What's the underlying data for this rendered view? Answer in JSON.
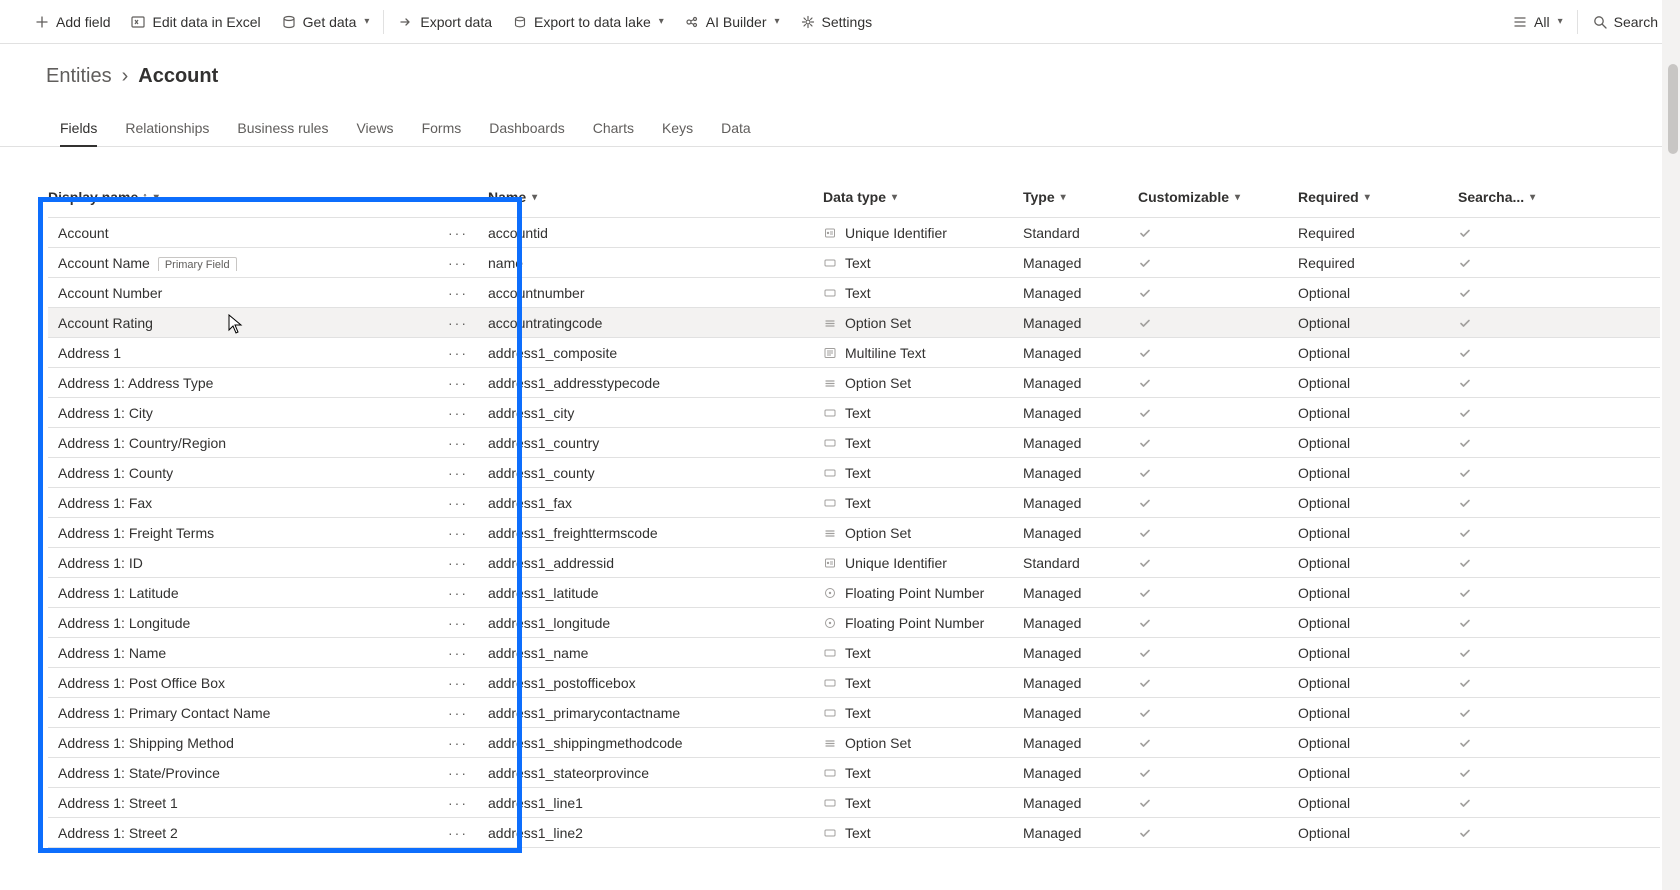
{
  "commandBar": {
    "left": [
      {
        "icon": "plus",
        "label": "Add field"
      },
      {
        "icon": "excel",
        "label": "Edit data in Excel"
      },
      {
        "icon": "db",
        "label": "Get data",
        "dropdown": true,
        "sepAfter": true
      },
      {
        "icon": "export",
        "label": "Export data"
      },
      {
        "icon": "lake",
        "label": "Export to data lake",
        "dropdown": true
      },
      {
        "icon": "ai",
        "label": "AI Builder",
        "dropdown": true
      },
      {
        "icon": "gear",
        "label": "Settings"
      }
    ],
    "right": {
      "filterLabel": "All",
      "searchPlaceholder": "Search"
    }
  },
  "breadcrumb": {
    "parent": "Entities",
    "current": "Account"
  },
  "tabs": [
    "Fields",
    "Relationships",
    "Business rules",
    "Views",
    "Forms",
    "Dashboards",
    "Charts",
    "Keys",
    "Data"
  ],
  "activeTab": 0,
  "columns": {
    "display": "Display name",
    "name": "Name",
    "dtype": "Data type",
    "type": "Type",
    "custom": "Customizable",
    "req": "Required",
    "search": "Searcha..."
  },
  "primaryBadge": "Primary Field",
  "rows": [
    {
      "display": "Account",
      "name": "accountid",
      "dtype": "Unique Identifier",
      "dicon": "id",
      "type": "Standard",
      "custom": true,
      "req": "Required",
      "search": true
    },
    {
      "display": "Account Name",
      "primary": true,
      "name": "name",
      "dtype": "Text",
      "dicon": "text",
      "type": "Managed",
      "custom": true,
      "req": "Required",
      "search": true
    },
    {
      "display": "Account Number",
      "name": "accountnumber",
      "dtype": "Text",
      "dicon": "text",
      "type": "Managed",
      "custom": true,
      "req": "Optional",
      "search": true
    },
    {
      "display": "Account Rating",
      "name": "accountratingcode",
      "dtype": "Option Set",
      "dicon": "opt",
      "type": "Managed",
      "custom": true,
      "req": "Optional",
      "search": true,
      "hover": true
    },
    {
      "display": "Address 1",
      "name": "address1_composite",
      "dtype": "Multiline Text",
      "dicon": "mtext",
      "type": "Managed",
      "custom": true,
      "req": "Optional",
      "search": true
    },
    {
      "display": "Address 1: Address Type",
      "name": "address1_addresstypecode",
      "dtype": "Option Set",
      "dicon": "opt",
      "type": "Managed",
      "custom": true,
      "req": "Optional",
      "search": true
    },
    {
      "display": "Address 1: City",
      "name": "address1_city",
      "dtype": "Text",
      "dicon": "text",
      "type": "Managed",
      "custom": true,
      "req": "Optional",
      "search": true
    },
    {
      "display": "Address 1: Country/Region",
      "name": "address1_country",
      "dtype": "Text",
      "dicon": "text",
      "type": "Managed",
      "custom": true,
      "req": "Optional",
      "search": true
    },
    {
      "display": "Address 1: County",
      "name": "address1_county",
      "dtype": "Text",
      "dicon": "text",
      "type": "Managed",
      "custom": true,
      "req": "Optional",
      "search": true
    },
    {
      "display": "Address 1: Fax",
      "name": "address1_fax",
      "dtype": "Text",
      "dicon": "text",
      "type": "Managed",
      "custom": true,
      "req": "Optional",
      "search": true
    },
    {
      "display": "Address 1: Freight Terms",
      "name": "address1_freighttermscode",
      "dtype": "Option Set",
      "dicon": "opt",
      "type": "Managed",
      "custom": true,
      "req": "Optional",
      "search": true
    },
    {
      "display": "Address 1: ID",
      "name": "address1_addressid",
      "dtype": "Unique Identifier",
      "dicon": "id",
      "type": "Standard",
      "custom": true,
      "req": "Optional",
      "search": true
    },
    {
      "display": "Address 1: Latitude",
      "name": "address1_latitude",
      "dtype": "Floating Point Number",
      "dicon": "float",
      "type": "Managed",
      "custom": true,
      "req": "Optional",
      "search": true
    },
    {
      "display": "Address 1: Longitude",
      "name": "address1_longitude",
      "dtype": "Floating Point Number",
      "dicon": "float",
      "type": "Managed",
      "custom": true,
      "req": "Optional",
      "search": true
    },
    {
      "display": "Address 1: Name",
      "name": "address1_name",
      "dtype": "Text",
      "dicon": "text",
      "type": "Managed",
      "custom": true,
      "req": "Optional",
      "search": true
    },
    {
      "display": "Address 1: Post Office Box",
      "name": "address1_postofficebox",
      "dtype": "Text",
      "dicon": "text",
      "type": "Managed",
      "custom": true,
      "req": "Optional",
      "search": true
    },
    {
      "display": "Address 1: Primary Contact Name",
      "name": "address1_primarycontactname",
      "dtype": "Text",
      "dicon": "text",
      "type": "Managed",
      "custom": true,
      "req": "Optional",
      "search": true
    },
    {
      "display": "Address 1: Shipping Method",
      "name": "address1_shippingmethodcode",
      "dtype": "Option Set",
      "dicon": "opt",
      "type": "Managed",
      "custom": true,
      "req": "Optional",
      "search": true
    },
    {
      "display": "Address 1: State/Province",
      "name": "address1_stateorprovince",
      "dtype": "Text",
      "dicon": "text",
      "type": "Managed",
      "custom": true,
      "req": "Optional",
      "search": true
    },
    {
      "display": "Address 1: Street 1",
      "name": "address1_line1",
      "dtype": "Text",
      "dicon": "text",
      "type": "Managed",
      "custom": true,
      "req": "Optional",
      "search": true
    },
    {
      "display": "Address 1: Street 2",
      "name": "address1_line2",
      "dtype": "Text",
      "dicon": "text",
      "type": "Managed",
      "custom": true,
      "req": "Optional",
      "search": true
    }
  ]
}
